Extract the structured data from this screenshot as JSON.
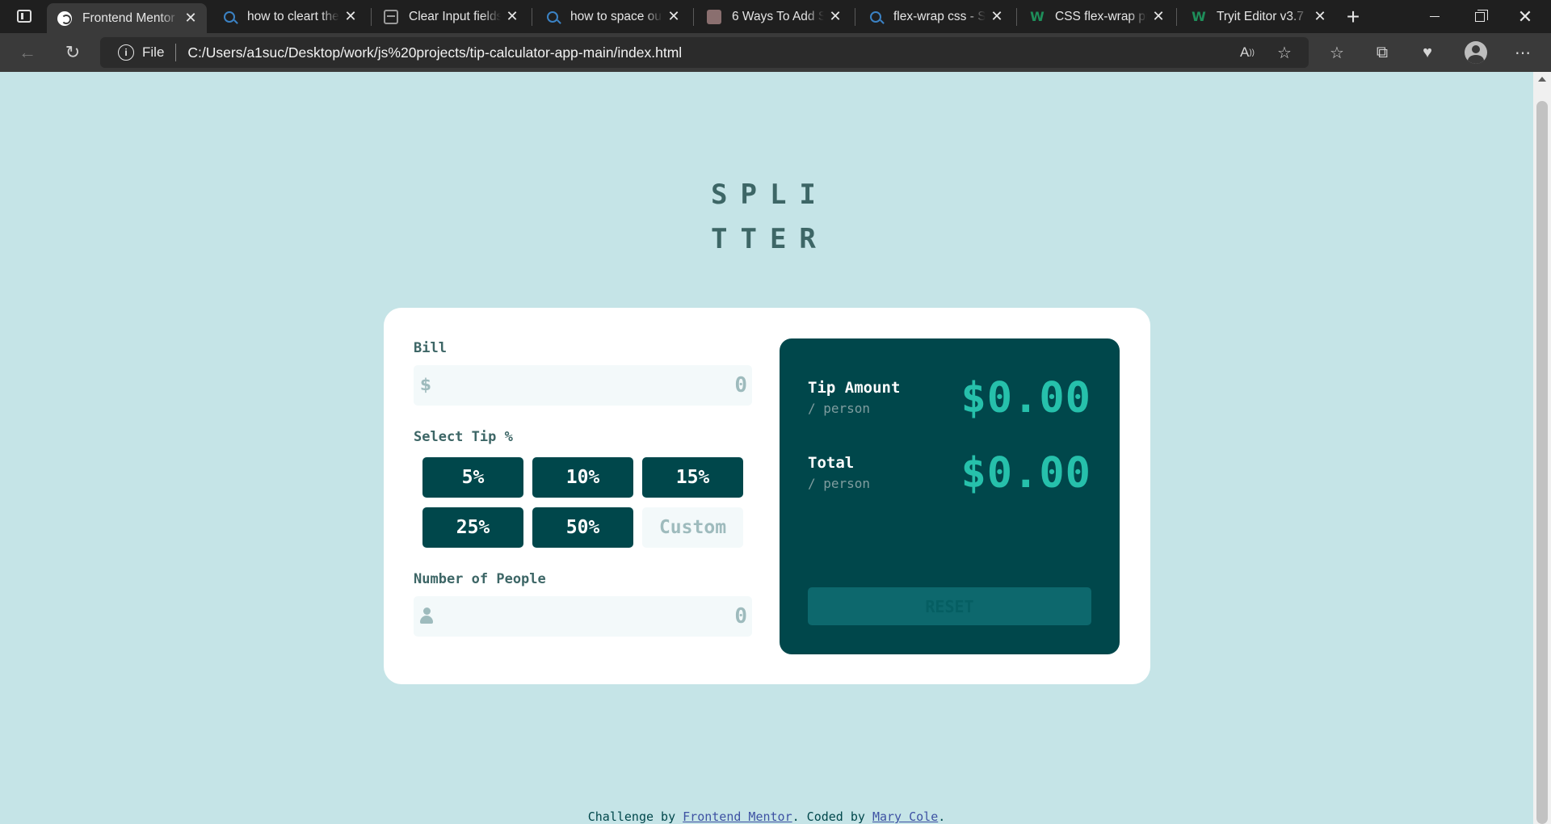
{
  "browser": {
    "tabs": [
      {
        "title": "Frontend Mentor",
        "icon": "frontend-mentor-icon",
        "active": true
      },
      {
        "title": "how to cleart the",
        "icon": "search-icon"
      },
      {
        "title": "Clear Input fields",
        "icon": "cube-icon"
      },
      {
        "title": "how to space out",
        "icon": "search-icon"
      },
      {
        "title": "6 Ways To Add Sp",
        "icon": "cube-icon"
      },
      {
        "title": "flex-wrap css - Se",
        "icon": "search-icon"
      },
      {
        "title": "CSS flex-wrap pro",
        "icon": "w3schools-icon"
      },
      {
        "title": "Tryit Editor v3.7",
        "icon": "w3schools-icon"
      }
    ],
    "address": {
      "scheme_label": "File",
      "url": "C:/Users/a1suc/Desktop/work/js%20projects/tip-calculator-app-main/index.html"
    }
  },
  "app": {
    "logo_line1": "SPLI",
    "logo_line2": "TTER",
    "bill": {
      "label": "Bill",
      "placeholder": "0",
      "icon": "dollar-icon"
    },
    "tip": {
      "label": "Select Tip %",
      "options": [
        "5%",
        "10%",
        "15%",
        "25%",
        "50%"
      ],
      "custom_placeholder": "Custom"
    },
    "people": {
      "label": "Number of People",
      "placeholder": "0",
      "icon": "person-icon"
    },
    "results": {
      "tip_title": "Tip Amount",
      "tip_sub": "/ person",
      "tip_value": "$0.00",
      "total_title": "Total",
      "total_sub": "/ person",
      "total_value": "$0.00",
      "reset_label": "RESET"
    },
    "attribution": {
      "prefix": "Challenge by ",
      "fm_link": "Frontend Mentor",
      "middle": ". Coded by ",
      "author_link": "Mary Cole",
      "suffix": "."
    }
  },
  "colors": {
    "page_bg": "#c5e4e7",
    "dark_cyan": "#00474b",
    "accent": "#26c0ab",
    "input_bg": "#f3f9fa"
  }
}
